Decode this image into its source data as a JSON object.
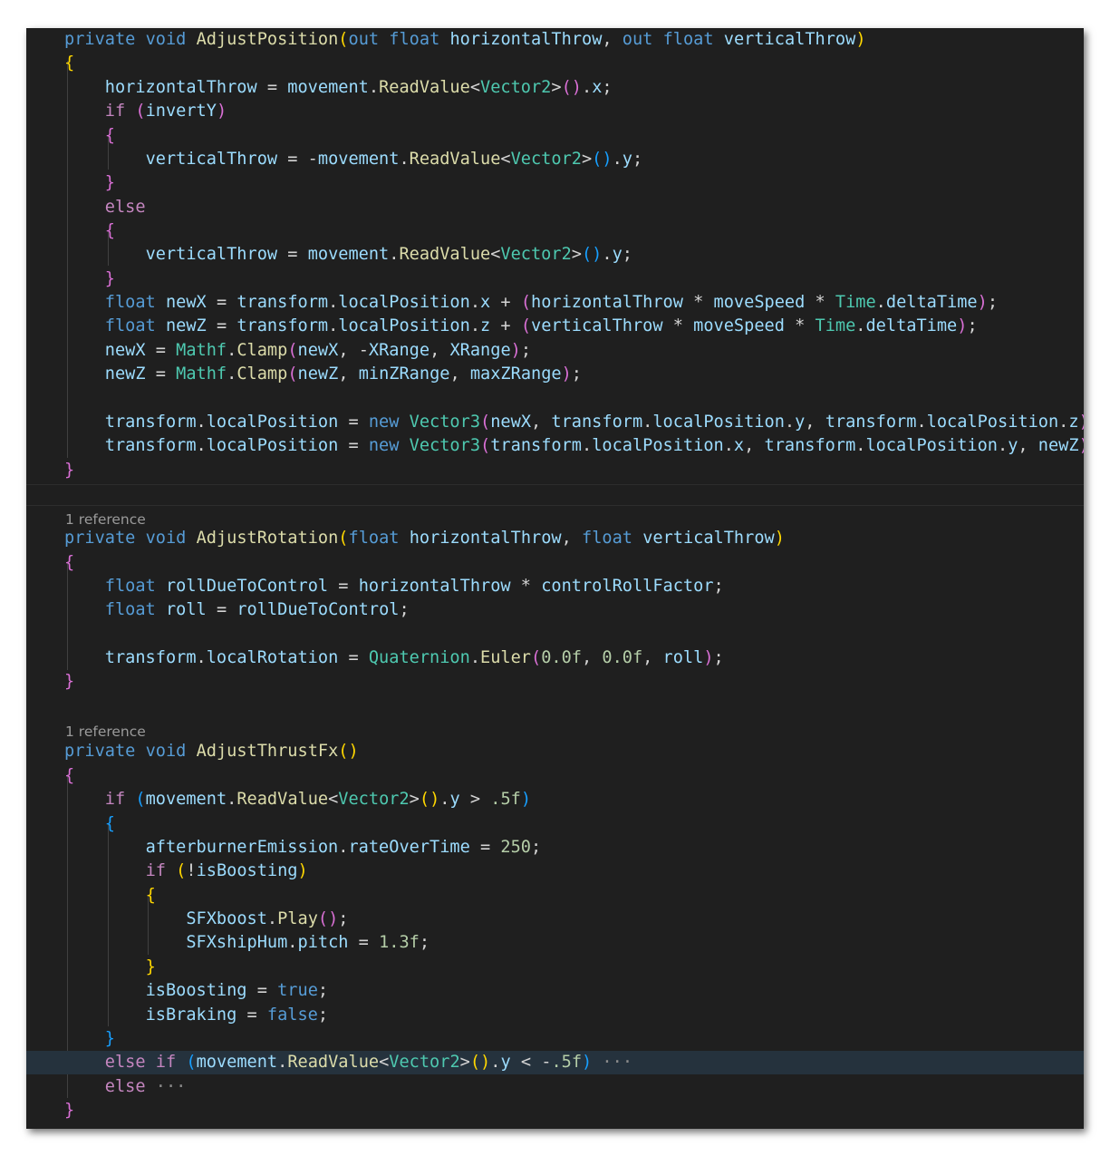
{
  "references": [
    "1 reference",
    "1 reference"
  ],
  "folded_ellipsis": "···",
  "lines": [
    [
      [
        "kw",
        "private"
      ],
      [
        "op",
        " "
      ],
      [
        "kw",
        "void"
      ],
      [
        "op",
        " "
      ],
      [
        "fn",
        "AdjustPosition"
      ],
      [
        "b1",
        "("
      ],
      [
        "kw",
        "out"
      ],
      [
        "op",
        " "
      ],
      [
        "kw",
        "float"
      ],
      [
        "op",
        " "
      ],
      [
        "vr",
        "horizontalThrow"
      ],
      [
        "op",
        ", "
      ],
      [
        "kw",
        "out"
      ],
      [
        "op",
        " "
      ],
      [
        "kw",
        "float"
      ],
      [
        "op",
        " "
      ],
      [
        "vr",
        "verticalThrow"
      ],
      [
        "b1",
        ")"
      ]
    ],
    [
      [
        "b1",
        "{"
      ]
    ],
    [
      [
        "op",
        "    "
      ],
      [
        "vr",
        "horizontalThrow"
      ],
      [
        "op",
        " = "
      ],
      [
        "vr",
        "movement"
      ],
      [
        "op",
        "."
      ],
      [
        "fn",
        "ReadValue"
      ],
      [
        "op",
        "<"
      ],
      [
        "ty",
        "Vector2"
      ],
      [
        "op",
        ">"
      ],
      [
        "b2",
        "()"
      ],
      [
        "op",
        "."
      ],
      [
        "vr",
        "x"
      ],
      [
        "op",
        ";"
      ]
    ],
    [
      [
        "op",
        "    "
      ],
      [
        "ctl",
        "if"
      ],
      [
        "op",
        " "
      ],
      [
        "b2",
        "("
      ],
      [
        "vr",
        "invertY"
      ],
      [
        "b2",
        ")"
      ]
    ],
    [
      [
        "op",
        "    "
      ],
      [
        "b2",
        "{"
      ]
    ],
    [
      [
        "op",
        "        "
      ],
      [
        "vr",
        "verticalThrow"
      ],
      [
        "op",
        " = -"
      ],
      [
        "vr",
        "movement"
      ],
      [
        "op",
        "."
      ],
      [
        "fn",
        "ReadValue"
      ],
      [
        "op",
        "<"
      ],
      [
        "ty",
        "Vector2"
      ],
      [
        "op",
        ">"
      ],
      [
        "b3",
        "()"
      ],
      [
        "op",
        "."
      ],
      [
        "vr",
        "y"
      ],
      [
        "op",
        ";"
      ]
    ],
    [
      [
        "op",
        "    "
      ],
      [
        "b2",
        "}"
      ]
    ],
    [
      [
        "op",
        "    "
      ],
      [
        "ctl",
        "else"
      ]
    ],
    [
      [
        "op",
        "    "
      ],
      [
        "b2",
        "{"
      ]
    ],
    [
      [
        "op",
        "        "
      ],
      [
        "vr",
        "verticalThrow"
      ],
      [
        "op",
        " = "
      ],
      [
        "vr",
        "movement"
      ],
      [
        "op",
        "."
      ],
      [
        "fn",
        "ReadValue"
      ],
      [
        "op",
        "<"
      ],
      [
        "ty",
        "Vector2"
      ],
      [
        "op",
        ">"
      ],
      [
        "b3",
        "()"
      ],
      [
        "op",
        "."
      ],
      [
        "vr",
        "y"
      ],
      [
        "op",
        ";"
      ]
    ],
    [
      [
        "op",
        "    "
      ],
      [
        "b2",
        "}"
      ]
    ],
    [
      [
        "op",
        "    "
      ],
      [
        "kw",
        "float"
      ],
      [
        "op",
        " "
      ],
      [
        "vr",
        "newX"
      ],
      [
        "op",
        " = "
      ],
      [
        "vr",
        "transform"
      ],
      [
        "op",
        "."
      ],
      [
        "vr",
        "localPosition"
      ],
      [
        "op",
        "."
      ],
      [
        "vr",
        "x"
      ],
      [
        "op",
        " + "
      ],
      [
        "b2",
        "("
      ],
      [
        "vr",
        "horizontalThrow"
      ],
      [
        "op",
        " * "
      ],
      [
        "vr",
        "moveSpeed"
      ],
      [
        "op",
        " * "
      ],
      [
        "ty",
        "Time"
      ],
      [
        "op",
        "."
      ],
      [
        "vr",
        "deltaTime"
      ],
      [
        "b2",
        ")"
      ],
      [
        "op",
        ";"
      ]
    ],
    [
      [
        "op",
        "    "
      ],
      [
        "kw",
        "float"
      ],
      [
        "op",
        " "
      ],
      [
        "vr",
        "newZ"
      ],
      [
        "op",
        " = "
      ],
      [
        "vr",
        "transform"
      ],
      [
        "op",
        "."
      ],
      [
        "vr",
        "localPosition"
      ],
      [
        "op",
        "."
      ],
      [
        "vr",
        "z"
      ],
      [
        "op",
        " + "
      ],
      [
        "b2",
        "("
      ],
      [
        "vr",
        "verticalThrow"
      ],
      [
        "op",
        " * "
      ],
      [
        "vr",
        "moveSpeed"
      ],
      [
        "op",
        " * "
      ],
      [
        "ty",
        "Time"
      ],
      [
        "op",
        "."
      ],
      [
        "vr",
        "deltaTime"
      ],
      [
        "b2",
        ")"
      ],
      [
        "op",
        ";"
      ]
    ],
    [
      [
        "op",
        "    "
      ],
      [
        "vr",
        "newX"
      ],
      [
        "op",
        " = "
      ],
      [
        "ty",
        "Mathf"
      ],
      [
        "op",
        "."
      ],
      [
        "fn",
        "Clamp"
      ],
      [
        "b2",
        "("
      ],
      [
        "vr",
        "newX"
      ],
      [
        "op",
        ", -"
      ],
      [
        "vr",
        "XRange"
      ],
      [
        "op",
        ", "
      ],
      [
        "vr",
        "XRange"
      ],
      [
        "b2",
        ")"
      ],
      [
        "op",
        ";"
      ]
    ],
    [
      [
        "op",
        "    "
      ],
      [
        "vr",
        "newZ"
      ],
      [
        "op",
        " = "
      ],
      [
        "ty",
        "Mathf"
      ],
      [
        "op",
        "."
      ],
      [
        "fn",
        "Clamp"
      ],
      [
        "b2",
        "("
      ],
      [
        "vr",
        "newZ"
      ],
      [
        "op",
        ", "
      ],
      [
        "vr",
        "minZRange"
      ],
      [
        "op",
        ", "
      ],
      [
        "vr",
        "maxZRange"
      ],
      [
        "b2",
        ")"
      ],
      [
        "op",
        ";"
      ]
    ],
    [
      [
        "op",
        ""
      ]
    ],
    [
      [
        "op",
        "    "
      ],
      [
        "vr",
        "transform"
      ],
      [
        "op",
        "."
      ],
      [
        "vr",
        "localPosition"
      ],
      [
        "op",
        " = "
      ],
      [
        "kw",
        "new"
      ],
      [
        "op",
        " "
      ],
      [
        "ty",
        "Vector3"
      ],
      [
        "b2",
        "("
      ],
      [
        "vr",
        "newX"
      ],
      [
        "op",
        ", "
      ],
      [
        "vr",
        "transform"
      ],
      [
        "op",
        "."
      ],
      [
        "vr",
        "localPosition"
      ],
      [
        "op",
        "."
      ],
      [
        "vr",
        "y"
      ],
      [
        "op",
        ", "
      ],
      [
        "vr",
        "transform"
      ],
      [
        "op",
        "."
      ],
      [
        "vr",
        "localPosition"
      ],
      [
        "op",
        "."
      ],
      [
        "vr",
        "z"
      ],
      [
        "b2",
        ")"
      ],
      [
        "op",
        ";"
      ]
    ],
    [
      [
        "op",
        "    "
      ],
      [
        "vr",
        "transform"
      ],
      [
        "op",
        "."
      ],
      [
        "vr",
        "localPosition"
      ],
      [
        "op",
        " = "
      ],
      [
        "kw",
        "new"
      ],
      [
        "op",
        " "
      ],
      [
        "ty",
        "Vector3"
      ],
      [
        "b2",
        "("
      ],
      [
        "vr",
        "transform"
      ],
      [
        "op",
        "."
      ],
      [
        "vr",
        "localPosition"
      ],
      [
        "op",
        "."
      ],
      [
        "vr",
        "x"
      ],
      [
        "op",
        ", "
      ],
      [
        "vr",
        "transform"
      ],
      [
        "op",
        "."
      ],
      [
        "vr",
        "localPosition"
      ],
      [
        "op",
        "."
      ],
      [
        "vr",
        "y"
      ],
      [
        "op",
        ", "
      ],
      [
        "vr",
        "newZ"
      ],
      [
        "b2",
        ")"
      ],
      [
        "op",
        ";"
      ]
    ],
    [
      [
        "b2",
        "}"
      ]
    ],
    [
      [
        "kw",
        "private"
      ],
      [
        "op",
        " "
      ],
      [
        "kw",
        "void"
      ],
      [
        "op",
        " "
      ],
      [
        "fn",
        "AdjustRotation"
      ],
      [
        "b1",
        "("
      ],
      [
        "kw",
        "float"
      ],
      [
        "op",
        " "
      ],
      [
        "vr",
        "horizontalThrow"
      ],
      [
        "op",
        ", "
      ],
      [
        "kw",
        "float"
      ],
      [
        "op",
        " "
      ],
      [
        "vr",
        "verticalThrow"
      ],
      [
        "b1",
        ")"
      ]
    ],
    [
      [
        "b2",
        "{"
      ]
    ],
    [
      [
        "op",
        "    "
      ],
      [
        "kw",
        "float"
      ],
      [
        "op",
        " "
      ],
      [
        "vr",
        "rollDueToControl"
      ],
      [
        "op",
        " = "
      ],
      [
        "vr",
        "horizontalThrow"
      ],
      [
        "op",
        " * "
      ],
      [
        "vr",
        "controlRollFactor"
      ],
      [
        "op",
        ";"
      ]
    ],
    [
      [
        "op",
        "    "
      ],
      [
        "kw",
        "float"
      ],
      [
        "op",
        " "
      ],
      [
        "vr",
        "roll"
      ],
      [
        "op",
        " = "
      ],
      [
        "vr",
        "rollDueToControl"
      ],
      [
        "op",
        ";"
      ]
    ],
    [
      [
        "op",
        ""
      ]
    ],
    [
      [
        "op",
        "    "
      ],
      [
        "vr",
        "transform"
      ],
      [
        "op",
        "."
      ],
      [
        "vr",
        "localRotation"
      ],
      [
        "op",
        " = "
      ],
      [
        "ty",
        "Quaternion"
      ],
      [
        "op",
        "."
      ],
      [
        "fn",
        "Euler"
      ],
      [
        "b2",
        "("
      ],
      [
        "nm",
        "0.0f"
      ],
      [
        "op",
        ", "
      ],
      [
        "nm",
        "0.0f"
      ],
      [
        "op",
        ", "
      ],
      [
        "vr",
        "roll"
      ],
      [
        "b2",
        ")"
      ],
      [
        "op",
        ";"
      ]
    ],
    [
      [
        "b2",
        "}"
      ]
    ],
    [
      [
        "kw",
        "private"
      ],
      [
        "op",
        " "
      ],
      [
        "kw",
        "void"
      ],
      [
        "op",
        " "
      ],
      [
        "fn",
        "AdjustThrustFx"
      ],
      [
        "b1",
        "()"
      ]
    ],
    [
      [
        "b2",
        "{"
      ]
    ],
    [
      [
        "op",
        "    "
      ],
      [
        "ctl",
        "if"
      ],
      [
        "op",
        " "
      ],
      [
        "b3",
        "("
      ],
      [
        "vr",
        "movement"
      ],
      [
        "op",
        "."
      ],
      [
        "fn",
        "ReadValue"
      ],
      [
        "op",
        "<"
      ],
      [
        "ty",
        "Vector2"
      ],
      [
        "op",
        ">"
      ],
      [
        "b1",
        "()"
      ],
      [
        "op",
        "."
      ],
      [
        "vr",
        "y"
      ],
      [
        "op",
        " > "
      ],
      [
        "nm",
        ".5f"
      ],
      [
        "b3",
        ")"
      ]
    ],
    [
      [
        "op",
        "    "
      ],
      [
        "b3",
        "{"
      ]
    ],
    [
      [
        "op",
        "        "
      ],
      [
        "vr",
        "afterburnerEmission"
      ],
      [
        "op",
        "."
      ],
      [
        "vr",
        "rateOverTime"
      ],
      [
        "op",
        " = "
      ],
      [
        "nm",
        "250"
      ],
      [
        "op",
        ";"
      ]
    ],
    [
      [
        "op",
        "        "
      ],
      [
        "ctl",
        "if"
      ],
      [
        "op",
        " "
      ],
      [
        "b1",
        "("
      ],
      [
        "op",
        "!"
      ],
      [
        "vr",
        "isBoosting"
      ],
      [
        "b1",
        ")"
      ]
    ],
    [
      [
        "op",
        "        "
      ],
      [
        "b1",
        "{"
      ]
    ],
    [
      [
        "op",
        "            "
      ],
      [
        "vr",
        "SFXboost"
      ],
      [
        "op",
        "."
      ],
      [
        "fn",
        "Play"
      ],
      [
        "b2",
        "()"
      ],
      [
        "op",
        ";"
      ]
    ],
    [
      [
        "op",
        "            "
      ],
      [
        "vr",
        "SFXshipHum"
      ],
      [
        "op",
        "."
      ],
      [
        "vr",
        "pitch"
      ],
      [
        "op",
        " = "
      ],
      [
        "nm",
        "1.3f"
      ],
      [
        "op",
        ";"
      ]
    ],
    [
      [
        "op",
        "        "
      ],
      [
        "b1",
        "}"
      ]
    ],
    [
      [
        "op",
        "        "
      ],
      [
        "vr",
        "isBoosting"
      ],
      [
        "op",
        " = "
      ],
      [
        "kw",
        "true"
      ],
      [
        "op",
        ";"
      ]
    ],
    [
      [
        "op",
        "        "
      ],
      [
        "vr",
        "isBraking"
      ],
      [
        "op",
        " = "
      ],
      [
        "kw",
        "false"
      ],
      [
        "op",
        ";"
      ]
    ],
    [
      [
        "op",
        "    "
      ],
      [
        "b3",
        "}"
      ]
    ],
    [
      [
        "op",
        "    "
      ],
      [
        "ctl",
        "else"
      ],
      [
        "op",
        " "
      ],
      [
        "ctl",
        "if"
      ],
      [
        "op",
        " "
      ],
      [
        "b3",
        "("
      ],
      [
        "vr",
        "movement"
      ],
      [
        "op",
        "."
      ],
      [
        "fn",
        "ReadValue"
      ],
      [
        "op",
        "<"
      ],
      [
        "ty",
        "Vector2"
      ],
      [
        "op",
        ">"
      ],
      [
        "b1",
        "()"
      ],
      [
        "op",
        "."
      ],
      [
        "vr",
        "y"
      ],
      [
        "op",
        " < -"
      ],
      [
        "nm",
        ".5f"
      ],
      [
        "b3",
        ")"
      ],
      [
        "fold",
        " ···"
      ]
    ],
    [
      [
        "op",
        "    "
      ],
      [
        "ctl",
        "else"
      ],
      [
        "fold",
        " ···"
      ]
    ],
    [
      [
        "b2",
        "}"
      ]
    ]
  ]
}
